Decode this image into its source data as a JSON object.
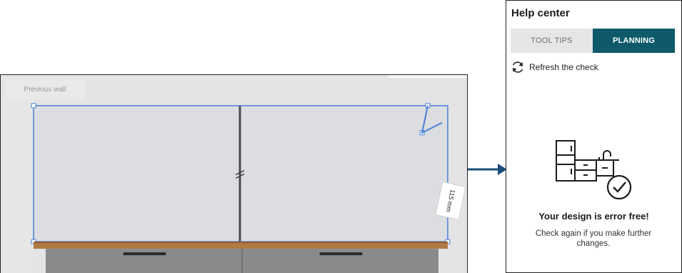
{
  "planner": {
    "previous_wall_label": "Previous wall",
    "dimension_label": "115 mm"
  },
  "help_center": {
    "title": "Help center",
    "tabs": [
      {
        "label": "TOOL TIPS",
        "active": false
      },
      {
        "label": "PLANNING",
        "active": true
      }
    ],
    "refresh_label": "Refresh the check",
    "status_title": "Your design is error free!",
    "status_subtitle": "Check again if you make further changes."
  },
  "colors": {
    "accent": "#0e5a6b",
    "selection": "#4a7fd6",
    "arrow": "#1a4d7a",
    "countertop": "#b07a43"
  },
  "icons": {
    "refresh": "refresh-icon",
    "status": "kitchen-check-icon",
    "connector": "arrow-right-icon"
  }
}
